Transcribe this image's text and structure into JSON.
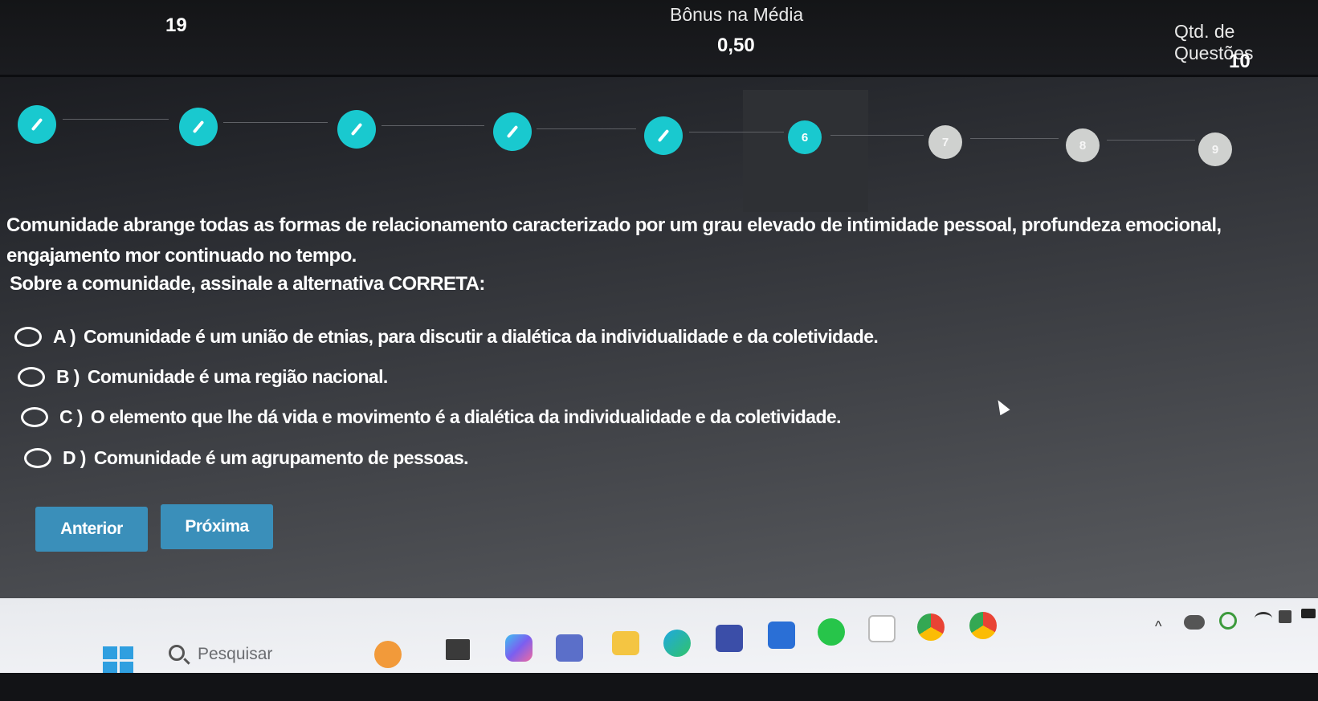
{
  "header": {
    "left_value": "19",
    "bonus_label": "Bônus na Média",
    "bonus_value": "0,50",
    "qtd_label": "Qtd. de Questões",
    "qtd_value": "10"
  },
  "progress": {
    "steps": [
      {
        "label": "",
        "status": "done"
      },
      {
        "label": "",
        "status": "done"
      },
      {
        "label": "",
        "status": "done"
      },
      {
        "label": "",
        "status": "done"
      },
      {
        "label": "",
        "status": "done"
      },
      {
        "label": "6",
        "status": "current"
      },
      {
        "label": "7",
        "status": "todo"
      },
      {
        "label": "8",
        "status": "todo"
      },
      {
        "label": "9",
        "status": "todo"
      }
    ]
  },
  "question": {
    "text": "Comunidade abrange todas as formas de relacionamento caracterizado por um grau elevado de intimidade pessoal, profundeza emocional, engajamento mor continuado no tempo.",
    "prompt": "Sobre a comunidade, assinale a alternativa CORRETA:"
  },
  "options": [
    {
      "letter": "A )",
      "text": "Comunidade é um união de etnias, para discutir a dialética da individualidade e da coletividade."
    },
    {
      "letter": "B )",
      "text": "Comunidade é uma região nacional."
    },
    {
      "letter": "C )",
      "text": "O elemento que lhe dá vida e movimento é a dialética da individualidade e da coletividade."
    },
    {
      "letter": "D )",
      "text": "Comunidade é um agrupamento de pessoas."
    }
  ],
  "buttons": {
    "previous": "Anterior",
    "next": "Próxima"
  },
  "taskbar": {
    "search_placeholder": "Pesquisar",
    "icons": [
      "windows-start-icon",
      "search-icon",
      "weather-icon",
      "task-view-icon",
      "copilot-icon",
      "teams-icon",
      "file-explorer-icon",
      "edge-icon",
      "app-icon",
      "store-icon",
      "whatsapp-icon",
      "word-icon",
      "chrome-icon",
      "chrome-profile-icon"
    ],
    "tray_icons": [
      "chevron-up-icon",
      "onedrive-icon",
      "sync-icon",
      "wifi-icon",
      "speaker-icon",
      "battery-icon"
    ]
  },
  "colors": {
    "accent": "#19c9cf",
    "button": "#3a8fba",
    "todo_step": "#cfd1cf"
  }
}
